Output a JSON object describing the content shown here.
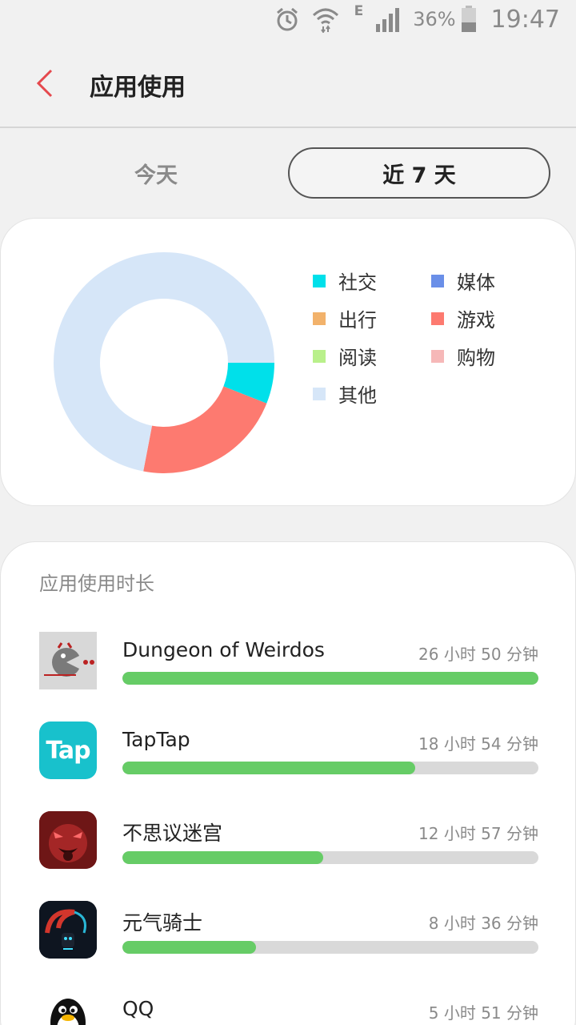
{
  "status_bar": {
    "network_type": "E",
    "battery": "36%",
    "time": "19:47"
  },
  "header": {
    "title": "应用使用"
  },
  "tabs": [
    {
      "label": "今天",
      "selected": false
    },
    {
      "label": "近 7 天",
      "selected": true
    }
  ],
  "chart_data": {
    "type": "pie",
    "title": "",
    "categories": [
      "社交",
      "媒体",
      "出行",
      "游戏",
      "阅读",
      "购物",
      "其他"
    ],
    "colors": [
      "#00e0ea",
      "#6a8fe8",
      "#f2b26b",
      "#fd7a70",
      "#b9f08b",
      "#f6b8b8",
      "#d6e6f8"
    ],
    "values": [
      6,
      0,
      0,
      22,
      0,
      0,
      72
    ],
    "legend_position": "right"
  },
  "usage": {
    "title": "应用使用时长",
    "max_minutes": 1610,
    "apps": [
      {
        "name": "Dungeon of Weirdos",
        "time": "26 小时 50 分钟",
        "minutes": 1610,
        "icon": "dungeon-of-weirdos-icon"
      },
      {
        "name": "TapTap",
        "time": "18 小时 54 分钟",
        "minutes": 1134,
        "icon": "taptap-icon",
        "icon_text": "Tap"
      },
      {
        "name": "不思议迷宫",
        "time": "12 小时 57 分钟",
        "minutes": 777,
        "icon": "maze-game-icon"
      },
      {
        "name": "元气骑士",
        "time": "8 小时 36 分钟",
        "minutes": 516,
        "icon": "soul-knight-icon"
      },
      {
        "name": "QQ",
        "time": "5 小时 51 分钟",
        "minutes": 351,
        "icon": "qq-penguin-icon"
      }
    ]
  }
}
